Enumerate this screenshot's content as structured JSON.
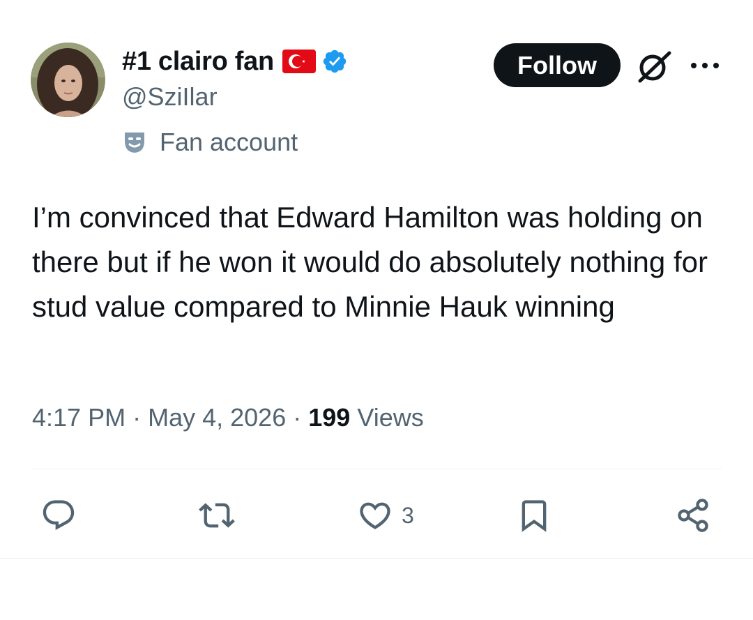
{
  "author": {
    "display_name": "#1 clairo fan",
    "handle": "@SziIlar",
    "label": "Fan account",
    "verified": true
  },
  "follow_button": {
    "label": "Follow"
  },
  "tweet": {
    "text": "I’m convinced that Edward Hamilton was holding on there but if he won it would do absolutely nothing for stud value compared to Minnie Hauk winning",
    "time": "4:17 PM",
    "date": "May 4, 2026",
    "views_count": "199",
    "views_label": "Views"
  },
  "actions": {
    "reply_count": "",
    "retweet_count": "",
    "like_count": "3"
  },
  "icons": {
    "flag": "turkey-flag-icon",
    "verified": "verified-badge-icon",
    "label": "theater-masks-icon",
    "grok": "grok-icon",
    "more": "more-icon",
    "reply": "reply-icon",
    "retweet": "retweet-icon",
    "like": "heart-icon",
    "bookmark": "bookmark-icon",
    "share": "share-icon"
  },
  "colors": {
    "text_primary": "#0f1419",
    "text_secondary": "#536471",
    "verified_blue": "#1d9bf0",
    "follow_bg": "#0f1419",
    "flag_red": "#e30a17"
  }
}
